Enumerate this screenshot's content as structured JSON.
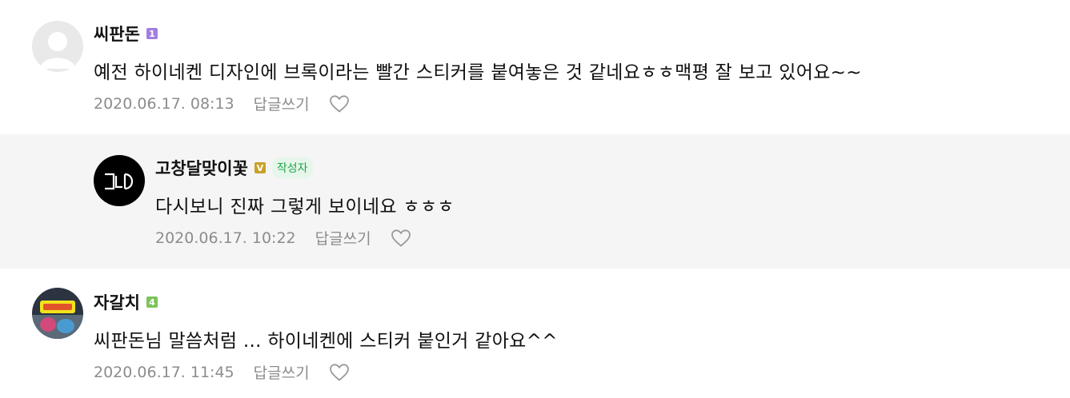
{
  "comments": [
    {
      "author": "씨판돈",
      "level": "1",
      "level_color": "#a27fe0",
      "text": "예전 하이네켄 디자인에 브록이라는 빨간 스티커를 붙여놓은 것 같네요ㅎㅎ맥평 잘 보고 있어요~~",
      "date": "2020.06.17. 08:13",
      "reply_label": "답글쓰기",
      "avatar_icon": "default-profile-icon"
    },
    {
      "author": "고창달맞이꽃",
      "level": "V",
      "level_color": "#c9a227",
      "author_tag": "작성자",
      "author_tag_color": "#21a64a",
      "text": "다시보니 진짜 그렇게 보이네요 ㅎㅎㅎ",
      "date": "2020.06.17. 10:22",
      "reply_label": "답글쓰기",
      "avatar_icon": "gcd-logo-avatar"
    },
    {
      "author": "자갈치",
      "level": "4",
      "level_color": "#7dc45a",
      "text": "씨판돈님 말씀처럼 ... 하이네켄에 스티커 붙인거 같아요^^",
      "date": "2020.06.17. 11:45",
      "reply_label": "답글쓰기",
      "avatar_icon": "photo-avatar"
    }
  ],
  "icons": {
    "like": "heart-outline-icon"
  },
  "colors": {
    "reply_bg": "#f5f5f5",
    "meta_text": "#8c8c8c"
  }
}
